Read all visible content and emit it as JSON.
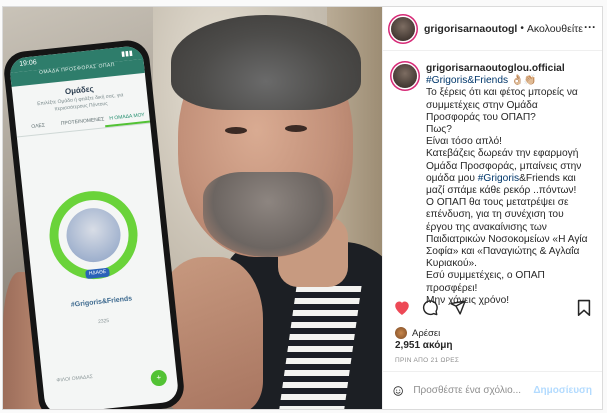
{
  "header": {
    "username": "grigorisarnaoutogl",
    "separator": "•",
    "follow_label": "Ακολουθείτε",
    "more_glyph": "···"
  },
  "caption": {
    "username": "grigorisarnaoutoglou.official",
    "hashtag_main": "#Grigoris&Friends",
    "emoji": "👌🏼👏🏼",
    "line1": "Το ξέρεις ότι και φέτος μπορείς να συμμετέχεις στην Ομάδα Προσφοράς του ΟΠΑΠ?",
    "line2": "Πως?",
    "line3": "Είναι τόσο απλό!",
    "line4_pre": "Κατεβάζεις δωρεάν την εφαρμογή Ομάδα Προσφοράς, μπαίνεις στην ομάδα μου ",
    "line4_tag_a": "#Grigoris",
    "line4_post": "&Friends και μαζί σπάμε κάθε ρεκόρ ..πόντων!",
    "line5_pre": "Ο ΟΠΑΠ θα τους μετατρέψει σε επένδυση, για τη συνέχιση του έργου της ανακαίνισης των Παιδιατρικών Νοσοκομείων «Η Αγία Σοφία» και «Παναγιώτης & Αγλαΐα Κυριακού».",
    "line6": "Εσύ συμμετέχεις, ο ΟΠΑΠ προσφέρει!",
    "line7": "Μην χάνεις χρόνο!"
  },
  "liked_by": "Αρέσει",
  "likes": {
    "count": "2,951",
    "suffix": " ακόμη"
  },
  "timestamp": "ΠΡΙΝ ΑΠΟ 21 ΩΡΕΣ",
  "comment": {
    "placeholder": "Προσθέστε ένα σχόλιο...",
    "post_label": "Δημοσίευση"
  },
  "phone_app": {
    "time": "19:06",
    "app_name": "ΟΜΑΔΑ ΠΡΟΣΦΟΡΑΣ ΟΠΑΠ",
    "title": "Ομάδες",
    "subtitle": "Επιλέξτε Ομάδα ή φτιάξτε δική σας, για περισσότερους Πόντους",
    "tabs": [
      "ΟΛΕΣ",
      "ΠΡΟΤΕΙΝΟΜΕΝΕΣ",
      "Η ΟΜΑΔΑ ΜΟΥ"
    ],
    "badge": "ΗΔΑΘΕ",
    "team_name": "#Grigoris&Friends",
    "team_count": "2325",
    "footer": "ΦΙΛΟΙ ΟΜΑΔΑΣ",
    "fab": "+"
  },
  "colors": {
    "like_red": "#ed4956",
    "link_blue": "#00376b",
    "post_button_disabled": "#b3dbff",
    "app_green": "#52c234"
  },
  "icons": {
    "like": "heart-filled-icon",
    "comment": "comment-bubble-icon",
    "share": "paper-plane-icon",
    "save": "bookmark-icon",
    "emoji": "smiley-icon"
  }
}
